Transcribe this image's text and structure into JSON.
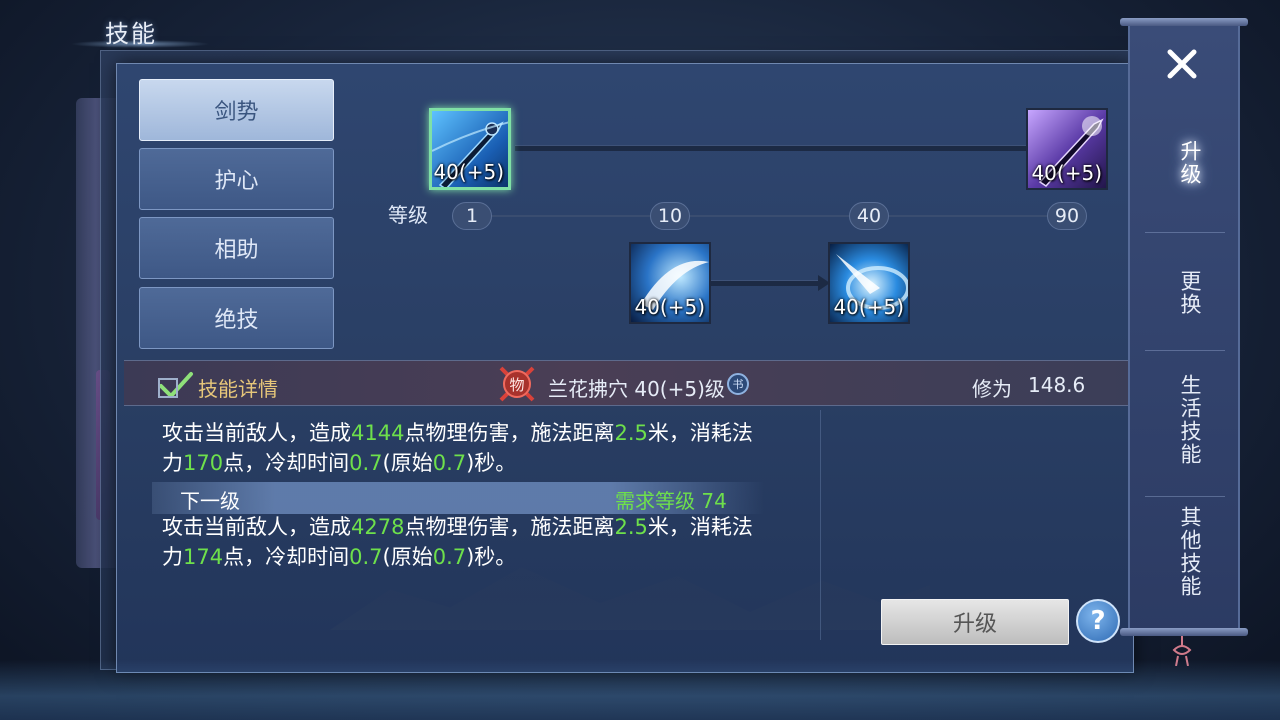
{
  "header": {
    "title": "技能"
  },
  "tabs": [
    {
      "label": "剑势",
      "active": true
    },
    {
      "label": "护心",
      "active": false
    },
    {
      "label": "相助",
      "active": false
    },
    {
      "label": "绝技",
      "active": false
    }
  ],
  "skill_tree": {
    "skills": [
      {
        "id": "skill-1",
        "level_text": "40(+5)",
        "icon": "blue-sword-icon",
        "selected": true
      },
      {
        "id": "skill-2",
        "level_text": "40(+5)",
        "icon": "purple-sword-icon",
        "selected": false
      },
      {
        "id": "skill-3",
        "level_text": "40(+5)",
        "icon": "slash-wave-icon",
        "selected": false
      },
      {
        "id": "skill-4",
        "level_text": "40(+5)",
        "icon": "whirl-strike-icon",
        "selected": false
      }
    ],
    "level_label": "等级",
    "levels": [
      "1",
      "10",
      "40",
      "90"
    ]
  },
  "detail": {
    "header_label": "技能详情",
    "badge_text": "物",
    "skill_line": "兰花拂穴 40(+5)级",
    "book_badge": "书",
    "xiuwei_label": "修为",
    "xiuwei_value": "148.6",
    "current": {
      "p1": "攻击当前敌人，造成",
      "damage": "4144",
      "p2": "点物理伤害，施法距离",
      "range": "2.5",
      "p3": "米，消耗法力",
      "mana": "170",
      "p4": "点，冷却时间",
      "cd": "0.7",
      "p5": "(原始",
      "cd_orig": "0.7",
      "p6": ")秒。"
    },
    "next_label": "下一级",
    "req_label": "需求等级 74",
    "next": {
      "p1": "攻击当前敌人，造成",
      "damage": "4278",
      "p2": "点物理伤害，施法距离",
      "range": "2.5",
      "p3": "米，消耗法力",
      "mana": "174",
      "p4": "点，冷却时间",
      "cd": "0.7",
      "p5": "(原始",
      "cd_orig": "0.7",
      "p6": ")秒。"
    }
  },
  "actions": {
    "upgrade_label": "升级",
    "help_label": "?"
  },
  "side_menu": {
    "items": [
      {
        "label": "升级",
        "active": true
      },
      {
        "label": "更换",
        "active": false
      },
      {
        "label": "生活技能",
        "active": false
      },
      {
        "label": "其他技能",
        "active": false
      }
    ]
  },
  "colors": {
    "highlight_green": "#6ee04b",
    "gold_label": "#e7c77a",
    "selected_border": "#7fe0a6"
  }
}
